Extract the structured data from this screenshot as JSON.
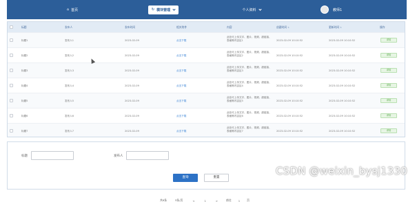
{
  "nav": {
    "home_label": "首页",
    "active_label": "模块管理",
    "personal_label": "个人资料",
    "user_label": "教师1"
  },
  "table": {
    "columns": [
      "标题",
      "发布人",
      "发布时间",
      "相关附件",
      "内容",
      "创建时间",
      "更新时间",
      "操作"
    ],
    "rows": [
      {
        "title": "标题1",
        "publisher": "发布人1",
        "date": "2023-02-09",
        "attach": "点击下载",
        "content": "此处可上传文字、图片、视频、超链接、表格等内容区1",
        "created": "2023-02-09 10:10:52",
        "updated": "2023-02-09 10:10:52",
        "action": "详情"
      },
      {
        "title": "标题2",
        "publisher": "发布人2",
        "date": "2023-02-09",
        "attach": "点击下载",
        "content": "此处可上传文字、图片、视频、超链接、表格等内容区2",
        "created": "2023-02-09 10:10:52",
        "updated": "2023-02-09 10:10:52",
        "action": "详情"
      },
      {
        "title": "标题3",
        "publisher": "发布人3",
        "date": "2023-02-09",
        "attach": "点击下载",
        "content": "此处可上传文字、图片、视频、超链接、表格等内容区3",
        "created": "2023-02-09 10:10:52",
        "updated": "2023-02-09 10:10:52",
        "action": "详情"
      },
      {
        "title": "标题4",
        "publisher": "发布人4",
        "date": "2023-02-09",
        "attach": "点击下载",
        "content": "此处可上传文字、图片、视频、超链接、表格等内容区4",
        "created": "2023-02-09 10:10:52",
        "updated": "2023-02-09 10:10:52",
        "action": "详情"
      },
      {
        "title": "标题5",
        "publisher": "发布人5",
        "date": "2023-02-09",
        "attach": "点击下载",
        "content": "此处可上传文字、图片、视频、超链接、表格等内容区5",
        "created": "2023-02-09 10:10:52",
        "updated": "2023-02-09 10:10:52",
        "action": "详情"
      },
      {
        "title": "标题6",
        "publisher": "发布人6",
        "date": "2023-02-09",
        "attach": "点击下载",
        "content": "此处可上传文字、图片、视频、超链接、表格等内容区6",
        "created": "2023-02-09 10:10:52",
        "updated": "2023-02-09 10:10:52",
        "action": "详情"
      },
      {
        "title": "标题7",
        "publisher": "发布人7",
        "date": "2023-02-09",
        "attach": "点击下载",
        "content": "此处可上传文字、图片、视频、超链接、表格等内容区7",
        "created": "2023-02-09 10:10:52",
        "updated": "2023-02-09 10:10:52",
        "action": "详情"
      }
    ]
  },
  "search": {
    "title_label": "标题",
    "publisher_label": "发布人",
    "title_value": "",
    "publisher_value": "",
    "query_button": "查询",
    "reset_button": "重置"
  },
  "pager": {
    "total": "共6条",
    "page_size": "5条/页",
    "prev": "<",
    "page": "1",
    "next": ">",
    "goto": "前往",
    "page_input": "1",
    "page_unit": "页"
  },
  "watermark": "CSDN @weixin_bysj1330",
  "colors": {
    "nav_bg": "#2c5e99",
    "header_bg": "#e2ebf5",
    "link": "#3a83d6",
    "primary_button": "#2d72c6",
    "detail_button_bg": "#e7f5e4"
  }
}
